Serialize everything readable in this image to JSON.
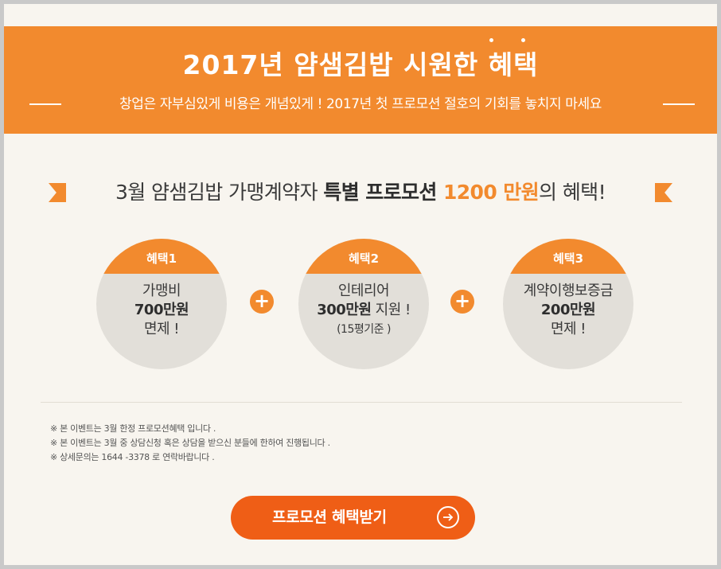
{
  "header": {
    "title": "2017년 얌샘김밥 시원한 혜택",
    "subtitle": "창업은 자부심있게 비용은 개념있게 ! 2017년 첫 프로모션 절호의 기회를 놓치지 마세요"
  },
  "headline": {
    "part1": "3월 얌샘김밥 가맹계약자 ",
    "bold": "특별 프로모션 ",
    "amount": "1200 만원",
    "part2": "의 혜택!"
  },
  "benefits": [
    {
      "label": "혜택1",
      "line1": "가맹비",
      "line2": "700만원",
      "line3": "면제 !"
    },
    {
      "label": "혜택2",
      "line1": "인테리어",
      "line2": "300만원",
      "line2_suffix": " 지원 !",
      "line3": "(15평기준 )"
    },
    {
      "label": "혜택3",
      "line1": "계약이행보증금",
      "line2": "200만원",
      "line3": "면제 !"
    }
  ],
  "plus_symbol": "+",
  "notes": [
    "※ 본 이벤트는 3월 한정 프로모션혜택 입니다 .",
    "※ 본 이벤트는 3월 중 상담신청 혹은 상담을 받으신 분들에 한하여 진행됩니다 .",
    "※ 상세문의는 1644 -3378 로 연락바랍니다 ."
  ],
  "cta": {
    "label": "프로모션 혜택받기",
    "icon": "arrow-right-circle-icon"
  },
  "colors": {
    "accent": "#f28a2e",
    "cta": "#ef5e16",
    "background": "#f8f5ef",
    "circle": "#e2dfd9"
  }
}
